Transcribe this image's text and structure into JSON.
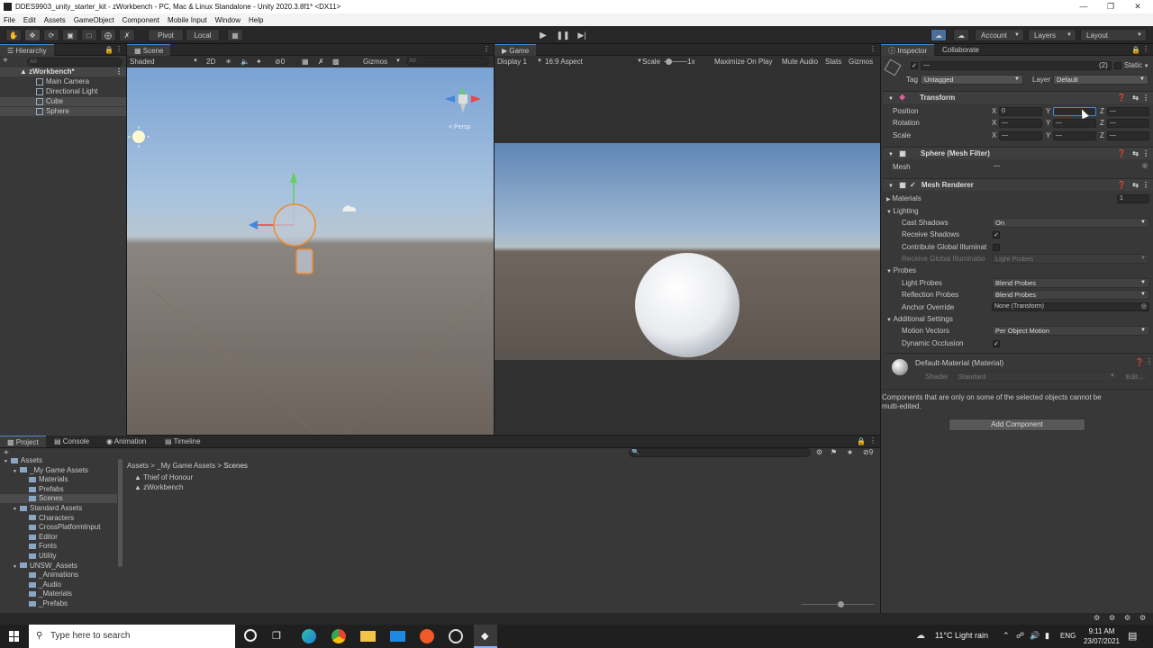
{
  "window": {
    "title": "DDES9903_unity_starter_kit - zWorkbench - PC, Mac & Linux Standalone - Unity 2020.3.8f1* <DX11>"
  },
  "menu": [
    "File",
    "Edit",
    "Assets",
    "GameObject",
    "Component",
    "Mobile Input",
    "Window",
    "Help"
  ],
  "toolbar": {
    "pivot": "Pivot",
    "local": "Local",
    "account": "Account",
    "layers": "Layers",
    "layout": "Layout"
  },
  "hierarchy": {
    "tab": "Hierarchy",
    "search_placeholder": "All",
    "scene": "zWorkbench*",
    "items": [
      "Main Camera",
      "Directional Light",
      "Cube",
      "Sphere"
    ]
  },
  "scene": {
    "tab": "Scene",
    "shading": "Shaded",
    "mode2d": "2D",
    "layers_count": "0",
    "gizmos": "Gizmos",
    "search_placeholder": "All",
    "persp": "< Persp"
  },
  "game": {
    "tab": "Game",
    "display": "Display 1",
    "aspect": "16:9 Aspect",
    "scale_label": "Scale",
    "scale_value": "1x",
    "maximize": "Maximize On Play",
    "mute": "Mute Audio",
    "stats": "Stats",
    "gizmos": "Gizmos"
  },
  "inspector": {
    "tab": "Inspector",
    "tab2": "Collaborate",
    "name_value": "—",
    "count": "(2)",
    "static": "Static",
    "tag_label": "Tag",
    "tag_value": "Untagged",
    "layer_label": "Layer",
    "layer_value": "Default",
    "transform": {
      "title": "Transform",
      "position_label": "Position",
      "rotation_label": "Rotation",
      "scale_label": "Scale",
      "x": "X",
      "y": "Y",
      "z": "Z",
      "pos_x": "0",
      "mixed": "—"
    },
    "meshfilter": {
      "title": "Sphere (Mesh Filter)",
      "mesh_label": "Mesh",
      "mesh_value": "—"
    },
    "meshrenderer": {
      "title": "Mesh Renderer",
      "materials": "Materials",
      "materials_count": "1",
      "lighting": "Lighting",
      "cast_shadows": "Cast Shadows",
      "cast_shadows_value": "On",
      "receive_shadows": "Receive Shadows",
      "contribute_gi": "Contribute Global Illuminat",
      "receive_gi": "Receive Global Illuminatio",
      "receive_gi_value": "Light Probes",
      "probes": "Probes",
      "light_probes": "Light Probes",
      "light_probes_value": "Blend Probes",
      "reflection_probes": "Reflection Probes",
      "reflection_probes_value": "Blend Probes",
      "anchor_override": "Anchor Override",
      "anchor_override_value": "None (Transform)",
      "additional": "Additional Settings",
      "motion_vectors": "Motion Vectors",
      "motion_vectors_value": "Per Object Motion",
      "dynamic_occlusion": "Dynamic Occlusion"
    },
    "material": {
      "title": "Default-Material (Material)",
      "shader_label": "Shader",
      "shader_value": "Standard",
      "edit": "Edit..."
    },
    "note": "Components that are only on some of the selected objects cannot be multi-edited.",
    "add_component": "Add Component"
  },
  "project": {
    "tabs": [
      "Project",
      "Console",
      "Animation",
      "Timeline"
    ],
    "tree": [
      {
        "label": "Assets",
        "indent": 0
      },
      {
        "label": "_My Game Assets",
        "indent": 1
      },
      {
        "label": "Materials",
        "indent": 2
      },
      {
        "label": "Prefabs",
        "indent": 2
      },
      {
        "label": "Scenes",
        "indent": 2
      },
      {
        "label": "Standard Assets",
        "indent": 1
      },
      {
        "label": "Characters",
        "indent": 2
      },
      {
        "label": "CrossPlatformInput",
        "indent": 2
      },
      {
        "label": "Editor",
        "indent": 2
      },
      {
        "label": "Fonts",
        "indent": 2
      },
      {
        "label": "Utility",
        "indent": 2
      },
      {
        "label": "UNSW_Assets",
        "indent": 1
      },
      {
        "label": "_Animations",
        "indent": 2
      },
      {
        "label": "_Audio",
        "indent": 2
      },
      {
        "label": "_Materials",
        "indent": 2
      },
      {
        "label": "_Prefabs",
        "indent": 2
      }
    ],
    "breadcrumb": [
      "Assets",
      "_My Game Assets",
      "Scenes"
    ],
    "files": [
      "Thief of Honour",
      "zWorkbench"
    ],
    "hidden_count": "9"
  },
  "taskbar": {
    "search_placeholder": "Type here to search",
    "weather": "11°C  Light rain",
    "lang": "ENG",
    "time": "9:11 AM",
    "date": "23/07/2021"
  },
  "colors": {
    "accent": "#4a8ad6",
    "selection": "#2c5d87",
    "panel": "#383838"
  }
}
